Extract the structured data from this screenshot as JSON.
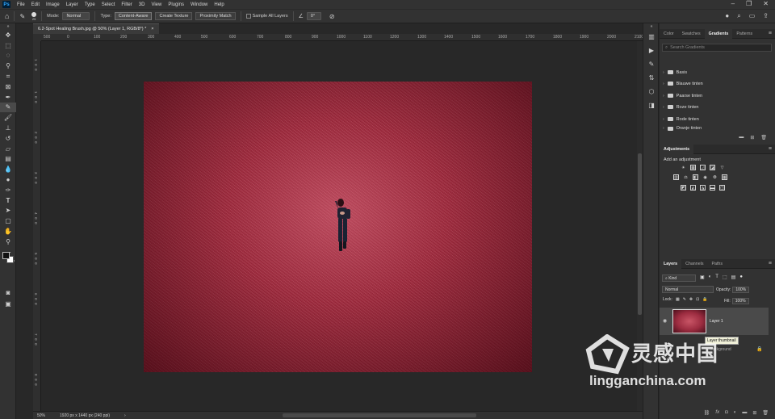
{
  "app": {
    "name": "Ps"
  },
  "menu": [
    "File",
    "Edit",
    "Image",
    "Layer",
    "Type",
    "Select",
    "Filter",
    "3D",
    "View",
    "Plugins",
    "Window",
    "Help"
  ],
  "options_bar": {
    "brush_size": "25",
    "mode_label": "Mode:",
    "mode_value": "Normal",
    "type_label": "Type:",
    "type_buttons": [
      "Content-Aware",
      "Create Texture",
      "Proximity Match"
    ],
    "sample_all_layers": "Sample All Layers",
    "angle": "0°"
  },
  "document": {
    "tab_title": "6.2-Spot Healing Brush.jpg @ 50% (Layer 1, RGB/8*) *",
    "ruler_h": [
      "500",
      "0",
      "100",
      "200",
      "300",
      "400",
      "500",
      "600",
      "700",
      "800",
      "900",
      "1000",
      "1100",
      "1200",
      "1300",
      "1400",
      "1500",
      "1600",
      "1700",
      "1800",
      "1900",
      "2000",
      "2100",
      "2200",
      "2300"
    ],
    "ruler_v": [
      "1",
      "0",
      "0",
      "1",
      "0",
      "0",
      "2",
      "0",
      "0",
      "3",
      "0",
      "0",
      "4",
      "0",
      "0",
      "5",
      "0",
      "0",
      "6",
      "0",
      "0",
      "7",
      "0",
      "0",
      "8",
      "0",
      "0",
      "9",
      "0",
      "0",
      "1",
      "0",
      "0",
      "0"
    ],
    "zoom": "50%",
    "doc_info": "1920 px x 1440 px (240 ppi)"
  },
  "gradients_panel": {
    "tabs": [
      "Color",
      "Swatches",
      "Gradients",
      "Patterns"
    ],
    "search_placeholder": "Search Gradients",
    "folders": [
      "Basis",
      "Blauwe tinten",
      "Paarse tinten",
      "Roze tinten",
      "Rode tinten",
      "Oranje tinten"
    ]
  },
  "adjustments_panel": {
    "tab": "Adjustments",
    "add_label": "Add an adjustment"
  },
  "layers_panel": {
    "tabs": [
      "Layers",
      "Channels",
      "Paths"
    ],
    "kind": "Kind",
    "blend_mode": "Normal",
    "opacity_label": "Opacity:",
    "opacity_value": "100%",
    "lock_label": "Lock:",
    "fill_label": "Fill:",
    "fill_value": "100%",
    "layers": [
      {
        "name": "Layer 1",
        "selected": true
      },
      {
        "name": "Background",
        "selected": false
      }
    ],
    "tooltip": "Layer thumbnail"
  },
  "watermark": {
    "cn": "灵感中国",
    "en": "lingganchina.com"
  }
}
